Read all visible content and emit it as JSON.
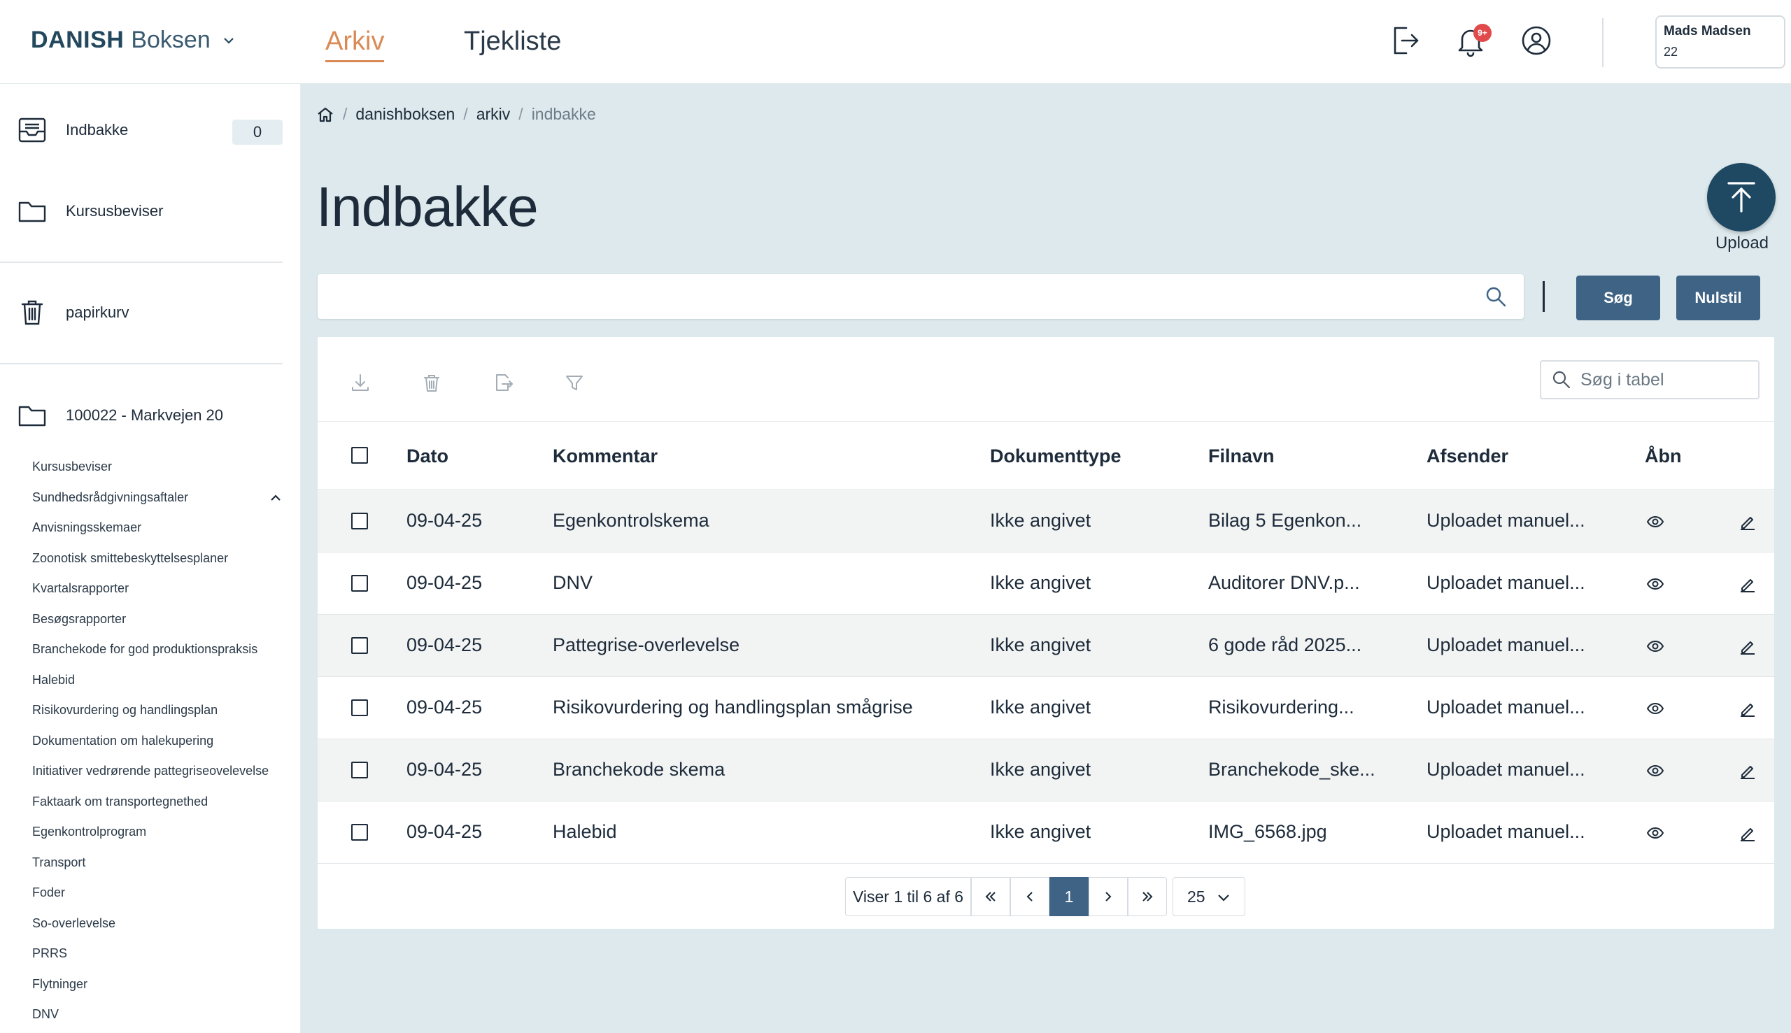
{
  "header": {
    "brand_bold": "DANISH",
    "brand_light": "Boksen",
    "tabs": [
      {
        "label": "Arkiv",
        "active": true
      },
      {
        "label": "Tjekliste",
        "active": false
      }
    ],
    "notification_badge": "9+",
    "user_name": "Mads Madsen",
    "user_id": "22",
    "icons": [
      "logout-icon",
      "bell-icon",
      "user-circle-icon"
    ]
  },
  "sidebar": {
    "inbox_label": "Indbakke",
    "inbox_count": "0",
    "certificates_label": "Kursusbeviser",
    "trash_label": "papirkurv",
    "farm_label": "100022 - Markvejen 20",
    "subfolders": [
      "Kursusbeviser",
      "Sundhedsrådgivningsaftaler",
      "Anvisningsskemaer",
      "Zoonotisk smittebeskyttelsesplaner",
      "Kvartalsrapporter",
      "Besøgsrapporter",
      "Branchekode for god produktionspraksis",
      "Halebid",
      "Risikovurdering og handlingsplan",
      "Dokumentation om halekupering",
      "Initiativer vedrørende pattegriseovelevelse",
      "Faktaark om transportegnethed",
      "Egenkontrolprogram",
      "Transport",
      "Foder",
      "So-overlevelse",
      "PRRS",
      "Flytninger",
      "DNV"
    ]
  },
  "breadcrumb": [
    "danishboksen",
    "arkiv",
    "indbakke"
  ],
  "page_title": "Indbakke",
  "upload_label": "Upload",
  "search": {
    "value": "",
    "placeholder": ""
  },
  "buttons": {
    "search": "Søg",
    "reset": "Nulstil"
  },
  "table": {
    "search_placeholder": "Søg i tabel",
    "columns": [
      "Dato",
      "Kommentar",
      "Dokumenttype",
      "Filnavn",
      "Afsender",
      "Åbn"
    ],
    "rows": [
      {
        "dato": "09-04-25",
        "kommentar": "Egenkontrolskema",
        "type": "Ikke angivet",
        "filnavn": "Bilag 5 Egenkon...",
        "afsender": "Uploadet manuel..."
      },
      {
        "dato": "09-04-25",
        "kommentar": "DNV",
        "type": "Ikke angivet",
        "filnavn": "Auditorer DNV.p...",
        "afsender": "Uploadet manuel..."
      },
      {
        "dato": "09-04-25",
        "kommentar": "Pattegrise-overlevelse",
        "type": "Ikke angivet",
        "filnavn": "6 gode råd 2025...",
        "afsender": "Uploadet manuel..."
      },
      {
        "dato": "09-04-25",
        "kommentar": "Risikovurdering og handlingsplan smågrise",
        "type": "Ikke angivet",
        "filnavn": "Risikovurdering...",
        "afsender": "Uploadet manuel..."
      },
      {
        "dato": "09-04-25",
        "kommentar": "Branchekode skema",
        "type": "Ikke angivet",
        "filnavn": "Branchekode_ske...",
        "afsender": "Uploadet manuel..."
      },
      {
        "dato": "09-04-25",
        "kommentar": "Halebid",
        "type": "Ikke angivet",
        "filnavn": "IMG_6568.jpg",
        "afsender": "Uploadet manuel..."
      }
    ]
  },
  "pagination": {
    "summary": "Viser 1 til 6 af 6",
    "current_page": "1",
    "page_size": "25"
  },
  "colors": {
    "brand": "#23485e",
    "accent": "#d98a55",
    "button": "#3e6385",
    "main_bg": "#dde9ed"
  }
}
